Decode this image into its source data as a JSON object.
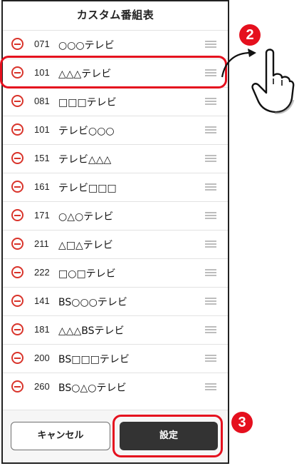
{
  "screen": {
    "title": "カスタム番組表"
  },
  "channels": [
    {
      "number": "071",
      "name": "○○○テレビ"
    },
    {
      "number": "101",
      "name": "△△△テレビ"
    },
    {
      "number": "081",
      "name": "□□□テレビ"
    },
    {
      "number": "101",
      "name": "テレビ○○○"
    },
    {
      "number": "151",
      "name": "テレビ△△△"
    },
    {
      "number": "161",
      "name": "テレビ□□□"
    },
    {
      "number": "171",
      "name": "○△○テレビ"
    },
    {
      "number": "211",
      "name": "△□△テレビ"
    },
    {
      "number": "222",
      "name": "□○□テレビ"
    },
    {
      "number": "141",
      "name": "BS○○○テレビ"
    },
    {
      "number": "181",
      "name": "△△△BSテレビ"
    },
    {
      "number": "200",
      "name": "BS□□□テレビ"
    },
    {
      "number": "260",
      "name": "BS○△○テレビ"
    }
  ],
  "footer": {
    "cancel_label": "キャンセル",
    "ok_label": "設定"
  },
  "annotations": {
    "step2": "2",
    "step3": "3"
  },
  "icons": {
    "row_delete": "minus-circle-icon",
    "row_handle": "drag-handle-icon",
    "pointer": "hand-pointer-icon"
  },
  "colors": {
    "accent_red": "#e5101e",
    "delete_red": "#d9342b",
    "primary_button": "#333333"
  }
}
